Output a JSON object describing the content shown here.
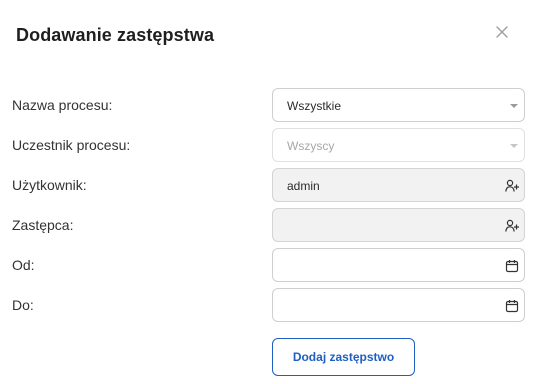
{
  "dialog": {
    "title": "Dodawanie zastępstwa",
    "close_icon": "close-icon"
  },
  "form": {
    "process_name": {
      "label": "Nazwa procesu:",
      "value": "Wszystkie",
      "icon": "chevron-down-icon"
    },
    "process_participant": {
      "label": "Uczestnik procesu:",
      "value": "Wszyscy",
      "icon": "chevron-down-icon",
      "disabled": true
    },
    "user": {
      "label": "Użytkownik:",
      "value": "admin",
      "icon": "add-user-icon"
    },
    "substitute": {
      "label": "Zastępca:",
      "value": "",
      "icon": "add-user-icon"
    },
    "from": {
      "label": "Od:",
      "value": "",
      "icon": "calendar-icon"
    },
    "to": {
      "label": "Do:",
      "value": "",
      "icon": "calendar-icon"
    }
  },
  "actions": {
    "submit_label": "Dodaj zastępstwo"
  },
  "colors": {
    "accent": "#1f5fbf",
    "border": "#cfcfcf",
    "filled_bg": "#f2f2f2"
  }
}
